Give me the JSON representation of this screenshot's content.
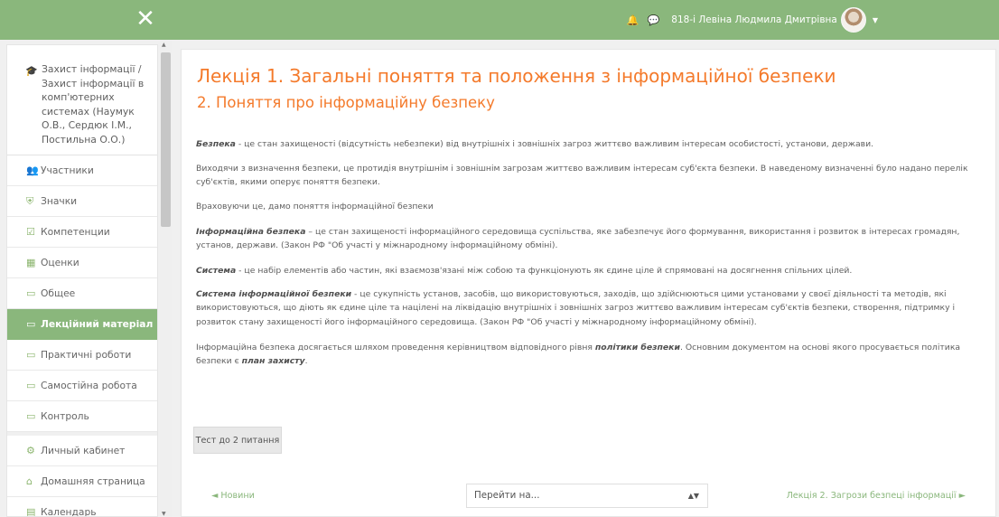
{
  "header": {
    "close_glyph": "✕",
    "bell_icon": "bell-icon",
    "chat_icon": "chat-icon",
    "username": "818-і Левіна Людмила Дмитрівна",
    "caret_icon": "chevron-down-icon"
  },
  "sidebar": {
    "course": "Захист інформації / Захист інформації в комп'ютерних системах (Наумук О.В., Сердюк І.М., Постильна О.О.)",
    "items": [
      {
        "label": "Участники",
        "icon": "users-icon"
      },
      {
        "label": "Значки",
        "icon": "shield-icon"
      },
      {
        "label": "Компетенции",
        "icon": "check-square-icon"
      },
      {
        "label": "Оценки",
        "icon": "table-icon"
      },
      {
        "label": "Общее",
        "icon": "folder-icon"
      },
      {
        "label": "Лекційний матеріал",
        "icon": "folder-icon",
        "active": true
      },
      {
        "label": "Практичні роботи",
        "icon": "folder-icon"
      },
      {
        "label": "Самостійна робота",
        "icon": "folder-icon"
      },
      {
        "label": "Контроль",
        "icon": "folder-icon"
      },
      {
        "label": "Личный кабинет",
        "icon": "dashboard-icon"
      },
      {
        "label": "Домашняя страница",
        "icon": "home-icon"
      },
      {
        "label": "Календарь",
        "icon": "calendar-icon"
      }
    ]
  },
  "main": {
    "title": "Лекція 1. Загальні поняття та положення з інформаційної безпеки",
    "subtitle": "2. Поняття про інформаційну безпеку",
    "paragraphs": {
      "p1_term": "Безпека",
      "p1_text": " - це стан захищеності (відсутність небезпеки) від внутрішніх і зовнішніх загроз життєво важливим інтересам особистості, установи, держави.",
      "p2_text": "Виходячи з визначення безпеки, це протидія внутрішнім і зовнішнім загрозам життєво важливим інтересам суб'єкта безпеки. В наведеному визначенні було надано перелік суб'єктів, якими оперує поняття безпеки.",
      "p3_text": "Враховуючи це, дамо поняття інформаційної безпеки",
      "p4_term": "Інформаційна безпека",
      "p4_text": " – це стан захищеності інформаційного середовища суспільства, яке забезпечує його формування, використання і розвиток в інтересах громадян, установ, держави. (Закон РФ \"Об участі у міжнародному інформаційному обміні).",
      "p5_term": "Система",
      "p5_text": " - це набір елементів або частин, які взаємозв'язані між собою та функціонують як єдине ціле й спрямовані на досягнення спільних цілей.",
      "p6_term": "Система інформаційної безпеки",
      "p6_text": " - це сукупність установ, засобів, що використовуються, заходів, що здійснюються цими установами у своєї діяльності та методів, які використовуються, що діють як єдине ціле та націлені на ліквідацію внутрішніх і зовнішніх загроз життєво важливим інтересам суб'єктів безпеки, створення, підтримку і розвиток стану захищеності його інформаційного середовища. (Закон РФ \"Об участі у міжнародному інформаційному обміні).",
      "p7_text_a": "Інформаційна безпека досягається шляхом проведення керівництвом відповідного рівня ",
      "p7_term_a": "політики безпеки",
      "p7_text_b": ". Основним документом на основі якого просувається політика безпеки є ",
      "p7_term_b": "план захисту",
      "p7_text_c": "."
    },
    "test_button": "Тест до 2 питання",
    "prev_link": "◄ Новини",
    "select_value": "Перейти на...",
    "next_link": "Лекція 2. Загрози безпеці інформації ►"
  }
}
